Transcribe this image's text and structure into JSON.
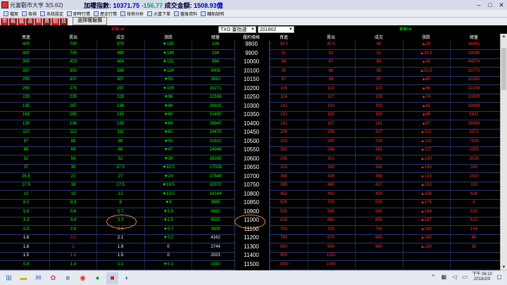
{
  "titlebar": {
    "app_title": "元富觀市大亨 3(5.62)",
    "index_label": "加權指數:",
    "index_value": "10371.75",
    "index_change": "-156.77",
    "turnover_label": "成交金額:",
    "turnover_value": "1508.93億"
  },
  "toolbar1": [
    "檔案",
    "檢視",
    "系統設定",
    "即時行情",
    "歷史行情",
    "技術分析",
    "元富下單",
    "盤後資料",
    "輔助說明"
  ],
  "toolbar2": [
    "市",
    "報",
    "盤",
    "選",
    "期",
    "資",
    "個",
    "技"
  ],
  "controls": {
    "product": "TXO 臺指選",
    "month": "201802",
    "strategy_button": "選擇權報價"
  },
  "side_labels": {
    "call": "買權Call",
    "put": "賣權Put"
  },
  "headers": {
    "call": [
      "買進",
      "賣出",
      "成交",
      "漲跌",
      "總量"
    ],
    "strike": "履約價格",
    "put": [
      "買進",
      "賣出",
      "成交",
      "漲跌",
      "總量"
    ]
  },
  "rows": [
    {
      "cb": "400",
      "cs": "700",
      "cl": "575",
      "cc": "▼155",
      "cv": "106",
      "k": "9800",
      "pb": "39.5",
      "ps": "40.5",
      "pl": "40",
      "pc": "▲28",
      "pv": "16491"
    },
    {
      "cb": "400",
      "cs": "700",
      "cl": "495",
      "cc": "▼145",
      "cv": "234",
      "k": "9900",
      "pb": "51",
      "ps": "52",
      "pl": "51",
      "pc": "▲34.5",
      "pv": "19096"
    },
    {
      "cb": "300",
      "cs": "423",
      "cl": "424",
      "cc": "▼121",
      "cv": "994",
      "k": "10000",
      "pb": "66",
      "ps": "67",
      "pl": "66",
      "pc": "▲43",
      "pv": "44574"
    },
    {
      "cb": "337",
      "cs": "350",
      "cl": "336",
      "cc": "▼114",
      "cv": "4008",
      "k": "10100",
      "pb": "85",
      "ps": "86",
      "pl": "85",
      "pc": "▲53.5",
      "pv": "20773"
    },
    {
      "cb": "290",
      "cs": "307",
      "cl": "307",
      "cc": "▼93",
      "cv": "3910",
      "k": "10150",
      "pb": "97",
      "ps": "99",
      "pl": "97",
      "pc": "▲60",
      "pv": "10252"
    },
    {
      "cb": "259",
      "cs": "275",
      "cl": "257",
      "cc": "▼105",
      "cv": "15271",
      "k": "10200",
      "pb": "109",
      "ps": "110",
      "pl": "110",
      "pc": "▲66",
      "pv": "22208"
    },
    {
      "cb": "229",
      "cs": "235",
      "cl": "229",
      "cc": "▼96",
      "cv": "12538",
      "k": "10250",
      "pb": "124",
      "ps": "127",
      "pl": "128",
      "pc": "▲74",
      "pv": "10629"
    },
    {
      "cb": "195",
      "cs": "197",
      "cl": "196",
      "cc": "▼86",
      "cv": "16825",
      "k": "10300",
      "pb": "142",
      "ps": "143",
      "pl": "143",
      "pc": "▲81",
      "pv": "19498"
    },
    {
      "cb": "161",
      "cs": "165",
      "cl": "163",
      "cc": "▼80",
      "cv": "11490",
      "k": "10350",
      "pb": "161",
      "ps": "162",
      "pl": "160",
      "pc": "▲86",
      "pv": "5421"
    },
    {
      "cb": "135",
      "cs": "136",
      "cl": "135",
      "cc": "▼69",
      "cv": "26847",
      "k": "10400",
      "pb": "181",
      "ps": "187",
      "pl": "181",
      "pc": "▲97",
      "pv": "18656"
    },
    {
      "cb": "110",
      "cs": "112",
      "cl": "111",
      "cc": "▼62",
      "cv": "24470",
      "k": "10450",
      "pb": "206",
      "ps": "208",
      "pl": "207",
      "pc": "▲102",
      "pv": "2373"
    },
    {
      "cb": "87",
      "cs": "88",
      "cl": "88",
      "cc": "▼55",
      "cv": "31611",
      "k": "10500",
      "pb": "233",
      "ps": "240",
      "pl": "234",
      "pc": "▲110",
      "pv": "7328"
    },
    {
      "cb": "68",
      "cs": "69",
      "cl": "68",
      "cc": "▼47",
      "cv": "24048",
      "k": "10550",
      "pb": "262",
      "ps": "268",
      "pl": "263",
      "pc": "▲117",
      "pv": "1205"
    },
    {
      "cb": "52",
      "cs": "54",
      "cl": "52",
      "cc": "▼39",
      "cv": "28285",
      "k": "10600",
      "pb": "295",
      "ps": "301",
      "pl": "301",
      "pc": "▲130",
      "pv": "3028"
    },
    {
      "cb": "37",
      "cs": "38",
      "cl": "37.5",
      "cc": "▼32.5",
      "cv": "17029",
      "k": "10650",
      "pb": "325",
      "ps": "340",
      "pl": "342",
      "pc": "▲140",
      "pv": "243"
    },
    {
      "cb": "26.5",
      "cs": "27",
      "cl": "27",
      "cc": "▼24",
      "cv": "17848",
      "k": "10700",
      "pb": "368",
      "ps": "405",
      "pl": "368",
      "pc": "▲133",
      "pv": "1010"
    },
    {
      "cb": "17.5",
      "cs": "18",
      "cl": "17.5",
      "cc": "▼19.5",
      "cv": "10372",
      "k": "10750",
      "pb": "385",
      "ps": "465",
      "pl": "417",
      "pc": "▲153",
      "pv": "119"
    },
    {
      "cb": "12",
      "cs": "13",
      "cl": "12",
      "cc": "▼13.5",
      "cv": "14144",
      "k": "10800",
      "pb": "452",
      "ps": "492",
      "pl": "459",
      "pc": "▲156",
      "pv": "626"
    },
    {
      "cb": "8.1",
      "cs": "8.3",
      "cl": "8",
      "cc": "▼9",
      "cv": "3895",
      "k": "10850",
      "pb": "505",
      "ps": "700",
      "pl": "525",
      "pc": "▲176",
      "pv": "6"
    },
    {
      "cb": "5.6",
      "cs": "5.8",
      "cl": "5.7",
      "cc": "▼5.8",
      "cv": "9430",
      "k": "10900",
      "pb": "555",
      "ps": "565",
      "pl": "563",
      "pc": "▲164",
      "pv": "529"
    },
    {
      "cb": "3.3",
      "cs": "3.4",
      "cl": "3.3",
      "cc": "▼2.5",
      "cv": "6525",
      "k": "11000",
      "pb": "615",
      "ps": "660",
      "pl": "650",
      "pc": "▲167",
      "pv": "613"
    },
    {
      "cb": "2.5",
      "cs": "2.6",
      "cl": "2.6",
      "cc": "▼0.7",
      "cv": "3509",
      "k": "11100",
      "pb": "750",
      "ps": "755",
      "pl": "740",
      "pc": "▲160",
      "pv": "154"
    },
    {
      "cb": "1.6",
      "cs": "2.1",
      "cl": "2.1",
      "cc": "▼0.2",
      "cv": "4162",
      "k": "11200",
      "pb": "780",
      "ps": "870",
      "pl": "840",
      "pc": "▲160",
      "pv": "86"
    },
    {
      "cb": "1.8",
      "cs": "2",
      "cl": "1.9",
      "cc": "0",
      "cv": "2744",
      "k": "11300",
      "pb": "850",
      "ps": "990",
      "pl": "960",
      "pc": "▲180",
      "pv": "35"
    },
    {
      "cb": "1.5",
      "cs": "1.6",
      "cl": "1.5",
      "cc": "0",
      "cv": "2023",
      "k": "11400",
      "pb": "950",
      "ps": "1150",
      "pl": "",
      "pc": "",
      "pv": ""
    },
    {
      "cb": "0.8",
      "cs": "1.4",
      "cl": "1.1",
      "cc": "▼0.1",
      "cv": "2150",
      "k": "11500",
      "pb": "1000",
      "ps": "1300",
      "pl": "",
      "pc": "",
      "pv": ""
    }
  ],
  "taskbar": {
    "apps": [
      "windows-start",
      "folder",
      "mail",
      "paint",
      "ie",
      "chrome",
      "line",
      "stock-app",
      "browser2"
    ],
    "time": "下午 06:10",
    "date": "2018/2/9"
  },
  "colors": {
    "up": "#ff3333",
    "down": "#00ff00",
    "grid": "#2a3868",
    "highlight_circle": "#e48a4f"
  }
}
